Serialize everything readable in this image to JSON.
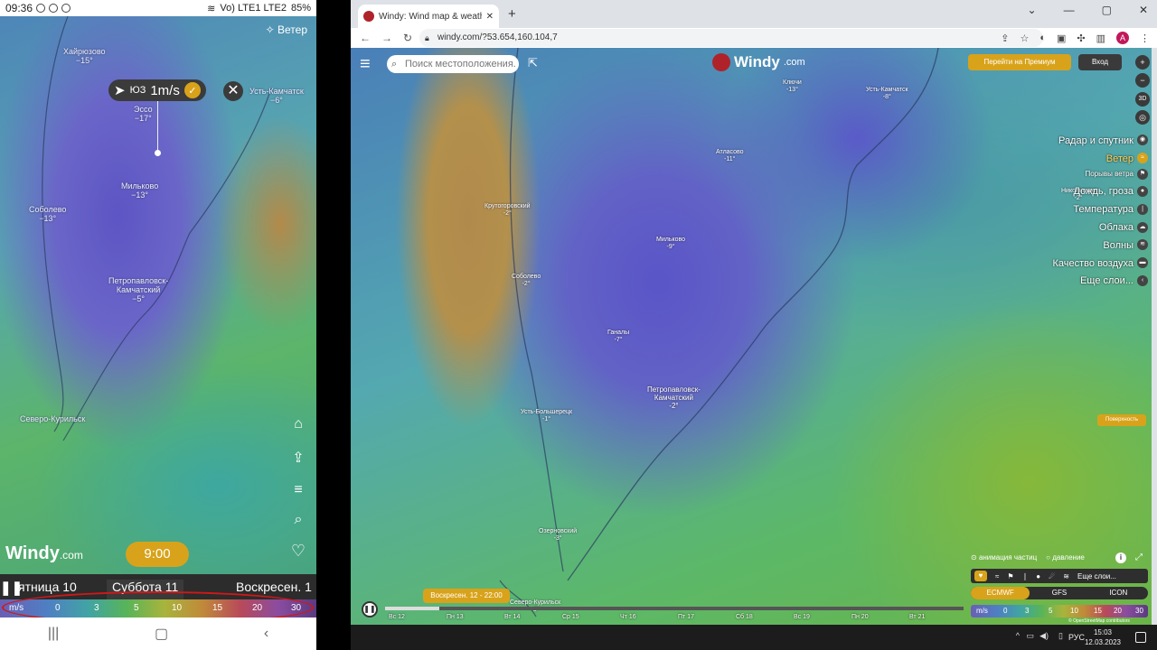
{
  "phone": {
    "status": {
      "time": "09:36",
      "battery": "85%",
      "net": "Vo) LTE1 LTE2"
    },
    "wind_layer_label": "Ветер",
    "cities": [
      {
        "name": "Хайрюзово",
        "temp": "−15°"
      },
      {
        "name": "Эссо",
        "temp": "−17°"
      },
      {
        "name": "Усть-Камчатск",
        "temp": "−6°"
      },
      {
        "name": "Мильково",
        "temp": "−13°"
      },
      {
        "name": "Соболево",
        "temp": "−13°"
      },
      {
        "name": "Петропавловск-",
        "temp": ""
      },
      {
        "name": "Камчатский",
        "temp": "−5°"
      },
      {
        "name": "Северо-Курильск",
        "temp": ""
      }
    ],
    "wind_pill": {
      "dir": "ЮЗ",
      "speed": "1m/s"
    },
    "close_label": "✕",
    "logo": {
      "main": "Windy",
      "suffix": ".com"
    },
    "time_badge": "9:00",
    "days": [
      "ятница 10",
      "Суббота 11",
      "Воскресен. 1"
    ],
    "scale": {
      "unit": "m/s",
      "ticks": [
        "0",
        "3",
        "5",
        "10",
        "15",
        "20",
        "30"
      ]
    },
    "icons": [
      "home-icon",
      "upload-icon",
      "menu-icon",
      "search-icon",
      "heart-icon"
    ]
  },
  "browser": {
    "tab_title": "Windy: Wind map & weather forec",
    "url": "windy.com/?53.654,160.104,7",
    "search_placeholder": "Поиск местоположения.",
    "logo": {
      "main": "Windy",
      "suffix": ".com"
    },
    "premium_label": "Перейти на Премиум",
    "login_label": "Вход",
    "view_3d": "3D",
    "cities": [
      {
        "name": "Ключи",
        "temp": "-13°"
      },
      {
        "name": "Усть-Камчатск",
        "temp": "-8°"
      },
      {
        "name": "Атласово",
        "temp": "-11°"
      },
      {
        "name": "Крутогоровский",
        "temp": "-2°"
      },
      {
        "name": "Мильково",
        "temp": "-9°"
      },
      {
        "name": "Соболево",
        "temp": "-2°"
      },
      {
        "name": "Ганалы",
        "temp": "-7°"
      },
      {
        "name": "Петропавловск-",
        "temp": ""
      },
      {
        "name": "Камчатский",
        "temp": "-2°"
      },
      {
        "name": "Усть-Большерецк",
        "temp": "-1°"
      },
      {
        "name": "Озерновский",
        "temp": "-3°"
      },
      {
        "name": "Северо-Курильск",
        "temp": "-3°"
      },
      {
        "name": "Никольское",
        "temp": "-2°"
      }
    ],
    "layers": [
      {
        "label": "Радар и спутник",
        "active": false
      },
      {
        "label": "Ветер",
        "active": true
      },
      {
        "label": "Порывы ветра",
        "active": false
      },
      {
        "label": "Дождь, гроза",
        "active": false
      },
      {
        "label": "Температура",
        "active": false
      },
      {
        "label": "Облака",
        "active": false
      },
      {
        "label": "Волны",
        "active": false
      },
      {
        "label": "Качество воздуха",
        "active": false
      },
      {
        "label": "Еще слои...",
        "active": false
      }
    ],
    "surface_label": "Поверхность",
    "particles_label": "анимация частиц",
    "pressure_label": "давление",
    "more_layers_label": "Еще слои...",
    "models": [
      {
        "label": "ECMWF",
        "active": true
      },
      {
        "label": "GFS",
        "active": false
      },
      {
        "label": "ICON",
        "active": false
      }
    ],
    "scale": {
      "unit": "m/s",
      "ticks": [
        "0",
        "3",
        "5",
        "10",
        "15",
        "20",
        "30"
      ]
    },
    "attribution": "© OpenStreetMap contributors",
    "timeline_badge": "Воскресен. 12 - 22:00",
    "timeline_days": [
      "Вс 12",
      "Пн 13",
      "Вт 14",
      "Ср 15",
      "Чт 16",
      "Пт 17",
      "Сб 18",
      "Вс 19",
      "Пн 20",
      "Вт 21"
    ]
  },
  "taskbar": {
    "lang": "РУС",
    "time": "15:03",
    "date": "12.03.2023"
  },
  "colors": {
    "accent": "#d8a31a",
    "brand": "#b0222a",
    "highlight_oval": "#d01818"
  }
}
